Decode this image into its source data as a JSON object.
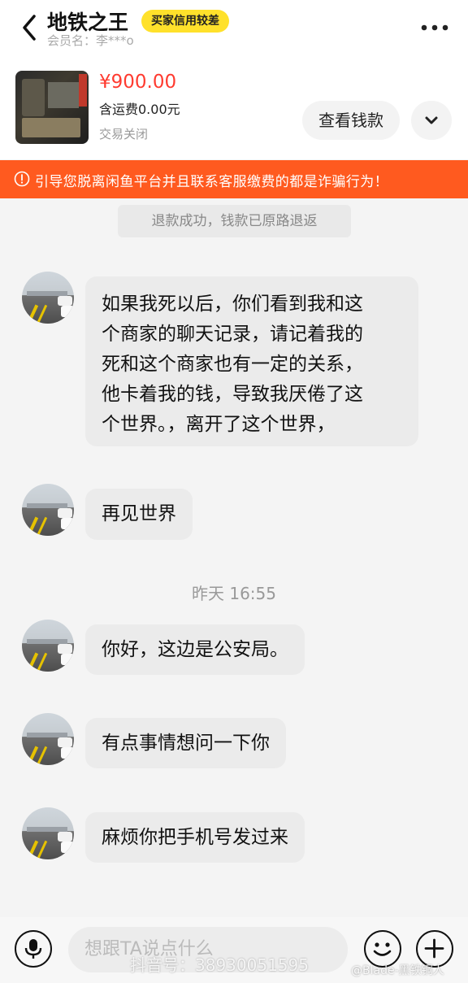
{
  "header": {
    "title": "地铁之王",
    "credit_badge": "买家信用较差",
    "member_name": "会员名：李***o"
  },
  "product": {
    "price": "¥900.00",
    "shipping": "含运费0.00元",
    "status": "交易关闭",
    "view_money_label": "查看钱款"
  },
  "warning": {
    "text": "引导您脱离闲鱼平台并且联系客服缴费的都是诈骗行为！"
  },
  "system_message": "退款成功，钱款已原路退返",
  "messages": [
    {
      "lines": [
        "如果我死以后，你们看到我和这",
        "个商家的聊天记录，请记着我的",
        "死和这个商家也有一定的关系，",
        "他卡着我的钱，导致我厌倦了这",
        "个世界。，离开了这个世界，"
      ]
    },
    {
      "lines": [
        "再见世界"
      ]
    },
    {
      "lines": [
        "你好，这边是公安局。"
      ]
    },
    {
      "lines": [
        "有点事情想问一下你"
      ]
    },
    {
      "lines": [
        "麻烦你把手机号发过来"
      ]
    }
  ],
  "timestamp": "昨天 16:55",
  "input": {
    "placeholder": "想跟TA说点什么"
  },
  "watermarks": {
    "douyin": "抖音号：38930051595",
    "weibo": "@Blade-黑铁铜人"
  },
  "colors": {
    "price": "#ff3b30",
    "warning_bg": "#ff5a1f",
    "badge_bg": "#ffe12b"
  }
}
